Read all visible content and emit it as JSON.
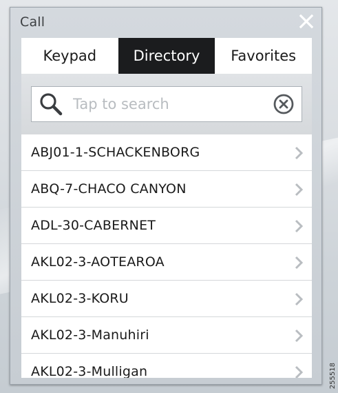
{
  "dialog": {
    "title": "Call",
    "close_icon": "close-x-icon"
  },
  "tabs": [
    {
      "label": "Keypad",
      "active": false
    },
    {
      "label": "Directory",
      "active": true
    },
    {
      "label": "Favorites",
      "active": false
    }
  ],
  "search": {
    "placeholder": "Tap to search",
    "value": "",
    "search_icon": "magnifier-icon",
    "clear_icon": "clear-circle-x-icon"
  },
  "directory": {
    "items": [
      {
        "label": "ABJ01-1-SCHACKENBORG"
      },
      {
        "label": "ABQ-7-CHACO CANYON"
      },
      {
        "label": "ADL-30-CABERNET"
      },
      {
        "label": "AKL02-3-AOTEAROA"
      },
      {
        "label": "AKL02-3-KORU"
      },
      {
        "label": "AKL02-3-Manuhiri"
      },
      {
        "label": "AKL02-3-Mulligan"
      }
    ]
  },
  "figure_id": "255518",
  "colors": {
    "active_tab_bg": "#1b1c1e",
    "active_tab_text": "#ffffff",
    "list_bg": "#ffffff",
    "chevron": "#b9bdc1"
  }
}
